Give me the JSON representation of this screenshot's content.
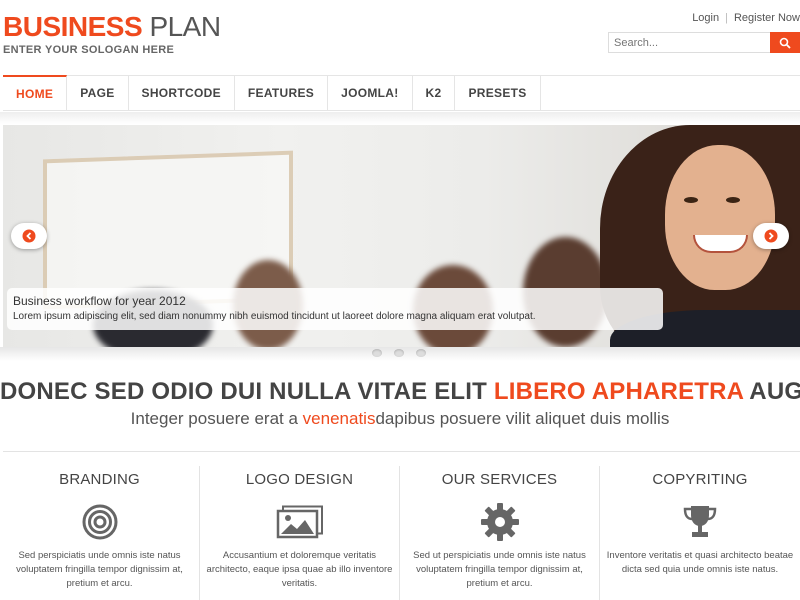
{
  "brand": {
    "name_part1": "BUSINESS",
    "name_part2": "PLAN",
    "slogan": "ENTER YOUR SOLOGAN HERE"
  },
  "top_links": {
    "login": "Login",
    "separator": "|",
    "register": "Register Now"
  },
  "search": {
    "placeholder": "Search..."
  },
  "nav": {
    "items": [
      {
        "label": "HOME",
        "active": true
      },
      {
        "label": "PAGE"
      },
      {
        "label": "SHORTCODE"
      },
      {
        "label": "FEATURES"
      },
      {
        "label": "JOOMLA!"
      },
      {
        "label": "K2"
      },
      {
        "label": "PRESETS"
      }
    ]
  },
  "slider": {
    "caption_title": "Business workflow for year 2012",
    "caption_text": "Lorem ipsum adipiscing elit, sed diam nonummy nibh euismod tincidunt ut laoreet dolore magna aliquam erat volutpat.",
    "slide_count": 3
  },
  "headline": {
    "part1": "DONEC SED ODIO DUI NULLA VITAE ELIT ",
    "highlight": "LIBERO APHARETRA",
    "part2": " AUGUE"
  },
  "subheadline": {
    "part1": "Integer posuere erat a ",
    "highlight": "venenatis",
    "part2": "dapibus posuere vilit aliquet duis mollis"
  },
  "features": [
    {
      "title": "BRANDING",
      "icon": "target-icon",
      "text": "Sed perspiciatis unde omnis iste natus voluptatem fringilla tempor dignissim at, pretium et arcu."
    },
    {
      "title": "LOGO DESIGN",
      "icon": "image-icon",
      "text": "Accusantium et doloremque veritatis architecto, eaque ipsa quae ab illo inventore veritatis."
    },
    {
      "title": "OUR SERVICES",
      "icon": "gear-icon",
      "text": "Sed ut perspiciatis unde omnis iste natus voluptatem fringilla tempor dignissim at, pretium et arcu."
    },
    {
      "title": "COPYRITING",
      "icon": "trophy-icon",
      "text": "Inventore veritatis et quasi architecto beatae dicta sed quia unde omnis iste natus."
    }
  ],
  "colors": {
    "accent": "#ef4a1e",
    "text": "#444444",
    "border": "#e3e3e3"
  }
}
